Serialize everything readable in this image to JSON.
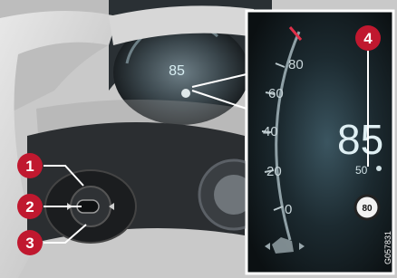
{
  "photo": {
    "description_free": true,
    "cluster_speed": "85",
    "inset": {
      "speed": "85",
      "set_speed": "50",
      "speed_limit_sign": "80",
      "scale_labels": [
        "80",
        "60",
        "40",
        "20",
        "0"
      ],
      "image_code": "G057831"
    }
  },
  "callouts": [
    {
      "number": "1"
    },
    {
      "number": "2"
    },
    {
      "number": "3"
    },
    {
      "number": "4"
    }
  ],
  "colors": {
    "callout_red": "#c0182f",
    "dashboard_dark": "#1f2326",
    "inset_background": "#101416",
    "display_teal": "#5fb3bd"
  }
}
